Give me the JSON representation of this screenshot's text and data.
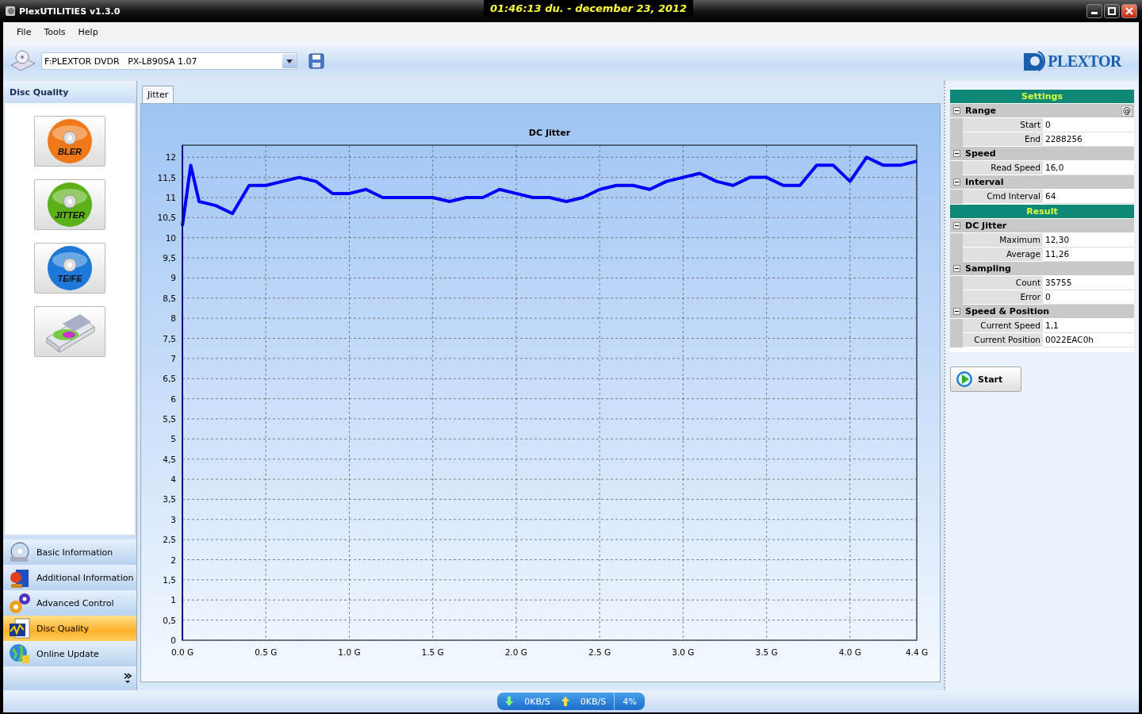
{
  "window": {
    "title": "PlexUTILITIES v1.3.0",
    "clock": "01:46:13 du. - december 23, 2012"
  },
  "menu": [
    "File",
    "Tools",
    "Help"
  ],
  "toolbar": {
    "drive": "F:PLEXTOR DVDR   PX-L890SA 1.07",
    "logo": "PLEXTOR"
  },
  "sidebar": {
    "title": "Disc Quality",
    "tools": [
      {
        "kind": "disc",
        "label": "BLER",
        "color": "#f07818"
      },
      {
        "kind": "disc",
        "label": "JITTER",
        "color": "#5cb018"
      },
      {
        "kind": "disc",
        "label": "TE/FE",
        "color": "#1e78d8"
      },
      {
        "kind": "drive"
      }
    ],
    "nav": [
      {
        "label": "Basic Information",
        "selected": false
      },
      {
        "label": "Additional Information",
        "selected": false
      },
      {
        "label": "Advanced Control",
        "selected": false
      },
      {
        "label": "Disc Quality",
        "selected": true
      },
      {
        "label": "Online Update",
        "selected": false
      }
    ]
  },
  "tabs": [
    {
      "label": "Jitter",
      "selected": true
    }
  ],
  "chart_data": {
    "type": "line",
    "title": "DC Jitter",
    "x": [
      0,
      0.05,
      0.1,
      0.2,
      0.3,
      0.4,
      0.5,
      0.6,
      0.7,
      0.8,
      0.9,
      1.0,
      1.1,
      1.2,
      1.3,
      1.4,
      1.5,
      1.6,
      1.7,
      1.8,
      1.9,
      2.0,
      2.1,
      2.2,
      2.3,
      2.4,
      2.5,
      2.6,
      2.7,
      2.8,
      2.9,
      3.0,
      3.1,
      3.2,
      3.3,
      3.4,
      3.5,
      3.6,
      3.7,
      3.8,
      3.9,
      4.0,
      4.1,
      4.2,
      4.3,
      4.4
    ],
    "grid": true,
    "series": [
      {
        "color": "#0000ff",
        "values": [
          10.3,
          11.8,
          10.9,
          10.8,
          10.6,
          11.3,
          11.3,
          11.4,
          11.5,
          11.4,
          11.1,
          11.1,
          11.2,
          11.0,
          11.0,
          11.0,
          11.0,
          10.9,
          11.0,
          11.0,
          11.2,
          11.1,
          11.0,
          11.0,
          10.9,
          11.0,
          11.2,
          11.3,
          11.3,
          11.2,
          11.4,
          11.5,
          11.6,
          11.4,
          11.3,
          11.5,
          11.5,
          11.3,
          11.3,
          11.8,
          11.8,
          11.4,
          12.0,
          11.8,
          11.8,
          11.9
        ]
      }
    ],
    "xlim": [
      0,
      4.4
    ],
    "ylim": [
      0,
      12.3
    ],
    "xticks": [
      {
        "value": 0,
        "label": "0.0 G"
      },
      {
        "value": 0.5,
        "label": "0.5 G"
      },
      {
        "value": 1,
        "label": "1.0 G"
      },
      {
        "value": 1.5,
        "label": "1.5 G"
      },
      {
        "value": 2,
        "label": "2.0 G"
      },
      {
        "value": 2.5,
        "label": "2.5 G"
      },
      {
        "value": 3,
        "label": "3.0 G"
      },
      {
        "value": 3.5,
        "label": "3.5 G"
      },
      {
        "value": 4,
        "label": "4.0 G"
      },
      {
        "value": 4.4,
        "label": "4.4 G"
      }
    ],
    "yticks": [
      0,
      {
        "value": 0.5,
        "label": "0,5"
      },
      1,
      {
        "value": 1.5,
        "label": "1,5"
      },
      2,
      {
        "value": 2.5,
        "label": "2,5"
      },
      3,
      {
        "value": 3.5,
        "label": "3,5"
      },
      4,
      {
        "value": 4.5,
        "label": "4,5"
      },
      5,
      {
        "value": 5.5,
        "label": "5,5"
      },
      6,
      {
        "value": 6.5,
        "label": "6,5"
      },
      7,
      {
        "value": 7.5,
        "label": "7,5"
      },
      8,
      {
        "value": 8.5,
        "label": "8,5"
      },
      9,
      {
        "value": 9.5,
        "label": "9,5"
      },
      10,
      {
        "value": 10.5,
        "label": "10,5"
      },
      11,
      {
        "value": 11.5,
        "label": "11,5"
      },
      12
    ]
  },
  "properties": [
    {
      "title": "Settings",
      "groups": [
        {
          "title": "Range",
          "expanded": true,
          "action": "@",
          "rows": [
            {
              "label": "Start",
              "value": "0"
            },
            {
              "label": "End",
              "value": "2288256"
            }
          ]
        },
        {
          "title": "Speed",
          "expanded": true,
          "rows": [
            {
              "label": "Read Speed",
              "value": "16,0"
            }
          ]
        },
        {
          "title": "Interval",
          "expanded": true,
          "rows": [
            {
              "label": "Cmd Interval",
              "value": "64"
            }
          ]
        }
      ]
    },
    {
      "title": "Result",
      "groups": [
        {
          "title": "DC Jitter",
          "expanded": true,
          "rows": [
            {
              "label": "Maximum",
              "value": "12,30"
            },
            {
              "label": "Average",
              "value": "11,26"
            }
          ]
        },
        {
          "title": "Sampling",
          "expanded": true,
          "rows": [
            {
              "label": "Count",
              "value": "35755"
            },
            {
              "label": "Error",
              "value": "0"
            }
          ]
        },
        {
          "title": "Speed & Position",
          "expanded": true,
          "rows": [
            {
              "label": "Current Speed",
              "value": "1,1"
            },
            {
              "label": "Current Position",
              "value": "0022EAC0h"
            }
          ]
        }
      ]
    }
  ],
  "start_button": "Start",
  "status": {
    "down": "0KB/S",
    "up": "0KB/S",
    "percent": "4%"
  }
}
